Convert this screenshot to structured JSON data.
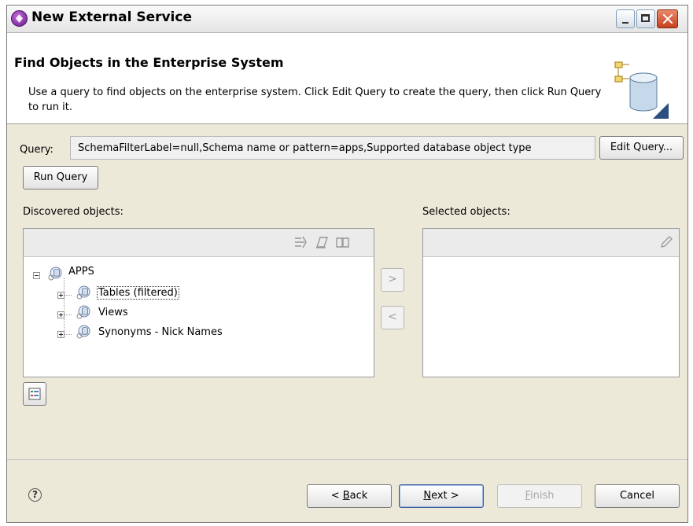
{
  "window": {
    "title": "New External Service"
  },
  "banner": {
    "title": "Find Objects in the Enterprise System",
    "description": "Use a query to find objects on the enterprise system.  Click Edit Query to create the query, then click Run Query to run it."
  },
  "query": {
    "label": "Query:",
    "value": "SchemaFilterLabel=null,Schema name or pattern=apps,Supported database object type",
    "edit_button": "Edit Query...",
    "run_button": "Run Query"
  },
  "discovered": {
    "label": "Discovered objects:",
    "tree": {
      "root": "APPS",
      "children": [
        "Tables (filtered)",
        "Views",
        "Synonyms - Nick Names"
      ]
    }
  },
  "selected": {
    "label": "Selected objects:"
  },
  "move_buttons": {
    "add": ">",
    "remove": "<"
  },
  "footer": {
    "help": "?",
    "back_prefix": "< ",
    "back_mnemonic": "B",
    "back_rest": "ack",
    "next_mnemonic": "N",
    "next_rest": "ext >",
    "finish_mnemonic": "F",
    "finish_rest": "inish",
    "cancel": "Cancel"
  },
  "colors": {
    "dialog_bg": "#ece9d8",
    "close_button": "#c7401e",
    "app_icon": "#6a1d8a"
  },
  "icons": {
    "app": "purple-globe-icon",
    "banner": "database-tree-icon",
    "tree_node": "database-icon"
  }
}
